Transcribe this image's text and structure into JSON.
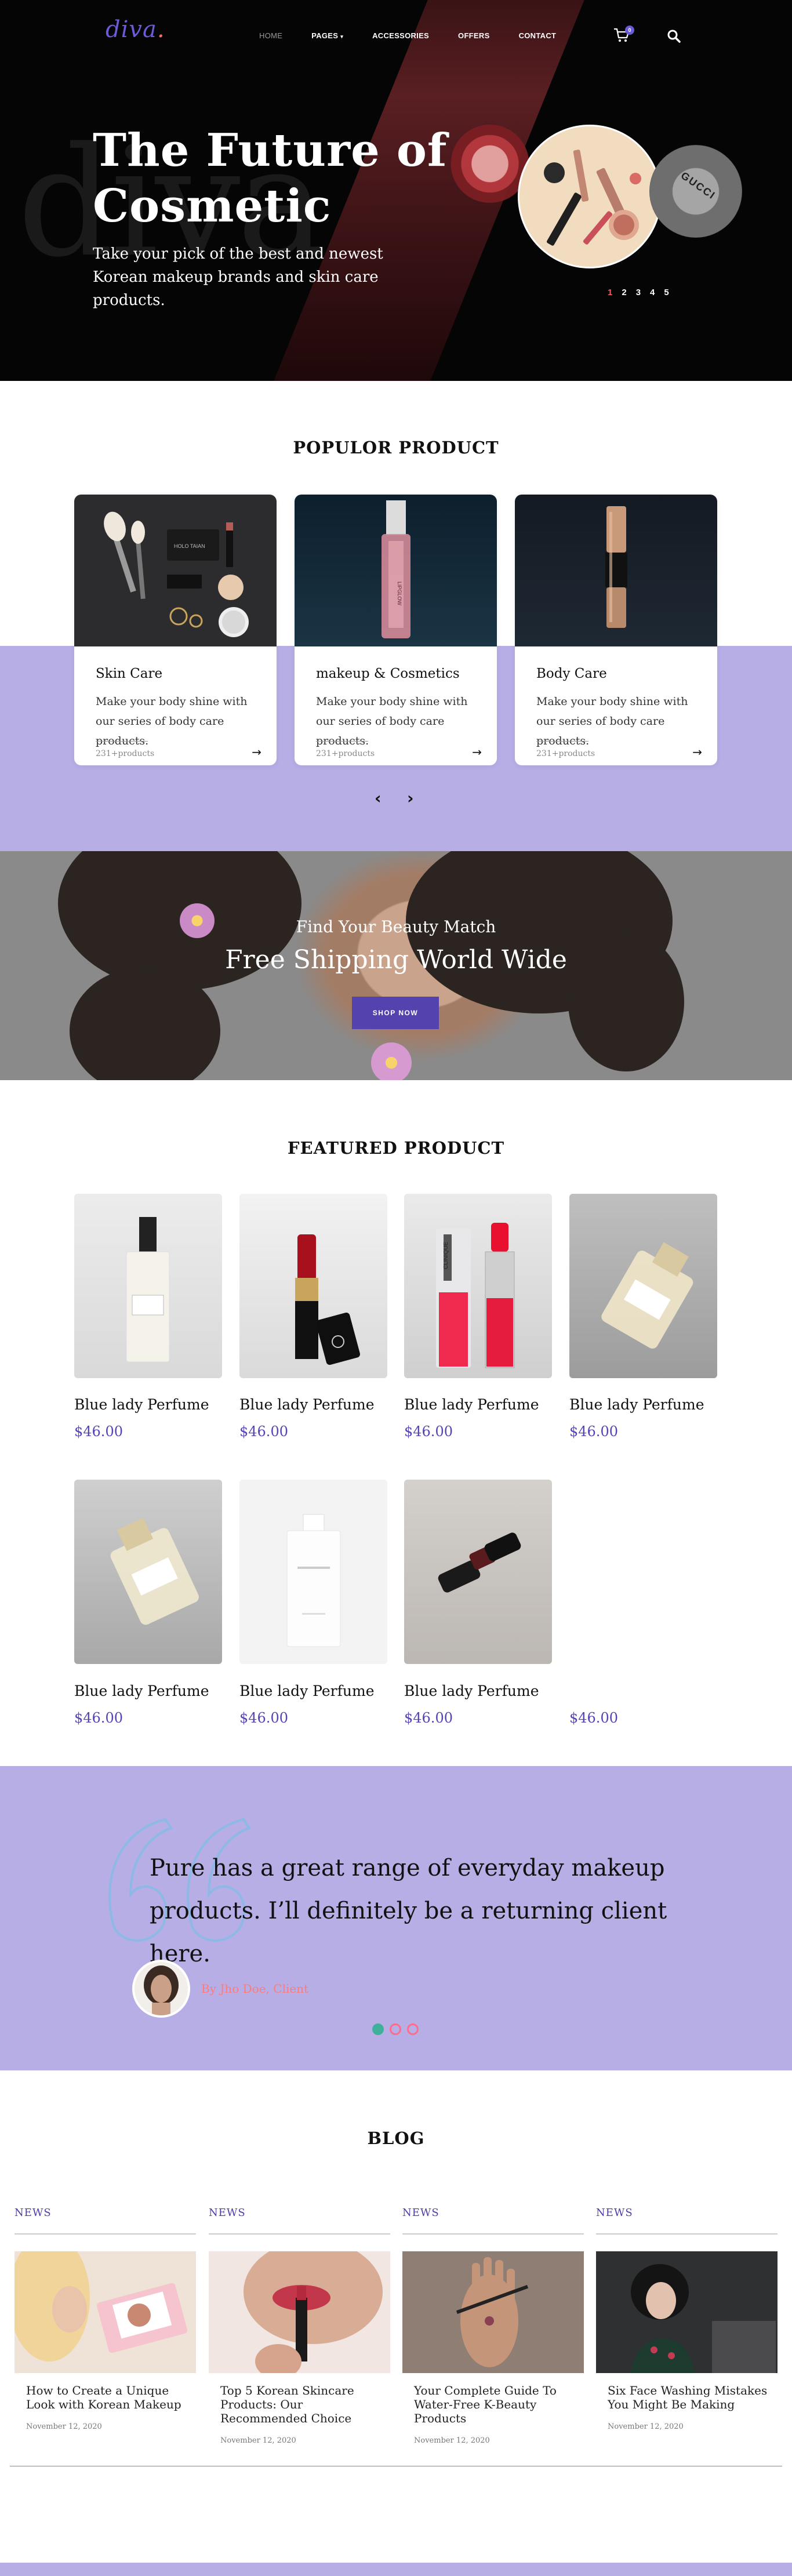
{
  "header": {
    "logo": "diva",
    "nav": [
      {
        "label": "HOME"
      },
      {
        "label": "PAGES"
      },
      {
        "label": "ACCESSORIES"
      },
      {
        "label": "OFFERS"
      },
      {
        "label": "CONTACT"
      }
    ],
    "cart_count": "0"
  },
  "hero": {
    "title": "The Future of Cosmetic",
    "subtitle": "Take your pick of the best and newest Korean makeup brands and skin care products.",
    "ghost_text": "diva",
    "badge_text": "GUCCI",
    "slides": [
      "1",
      "2",
      "3",
      "4",
      "5"
    ]
  },
  "popular": {
    "title": "POPULOR PRODUCT",
    "cards": [
      {
        "title": "Skin Care",
        "desc": "Make your body shine with our series of body care products.",
        "count": "231+products",
        "box_label": "HOLO TAIAN"
      },
      {
        "title": "makeup & Cosmetics",
        "desc": "Make your body shine with our series of body care products.",
        "count": "231+products",
        "box_label": "LIPGLOW"
      },
      {
        "title": "Body Care",
        "desc": "Make your body shine with our series of body care products.",
        "count": "231+products",
        "box_label": ""
      }
    ]
  },
  "shipping": {
    "subtitle": "Find Your Beauty Match",
    "title": "Free Shipping World Wide",
    "button": "SHOP NOW"
  },
  "featured": {
    "title": "FEATURED PRODUCT",
    "products": [
      {
        "name": "Blue lady Perfume",
        "price": "$46.00"
      },
      {
        "name": "Blue lady Perfume",
        "price": "$46.00"
      },
      {
        "name": "Blue lady Perfume",
        "price": "$46.00",
        "bottle_label": "CLINIQUE"
      },
      {
        "name": "Blue lady Perfume",
        "price": "$46.00"
      },
      {
        "name": "Blue lady Perfume",
        "price": "$46.00"
      },
      {
        "name": "Blue lady Perfume",
        "price": "$46.00"
      },
      {
        "name": "Blue lady Perfume",
        "price": "$46.00"
      },
      {
        "name": "",
        "price": "$46.00"
      }
    ]
  },
  "testimonial": {
    "text": "Pure has a great range of everyday makeup products. I’ll definitely be a returning client here.",
    "author": "By Jho Doe, Client"
  },
  "blog": {
    "title": "BLOG",
    "posts": [
      {
        "tag": "NEWS",
        "title": "How to Create a Unique Look with Korean Makeup",
        "date": "November 12, 2020"
      },
      {
        "tag": "NEWS",
        "title": "Top 5 Korean Skincare Products: Our Recommended Choice",
        "date": "November 12, 2020"
      },
      {
        "tag": "NEWS",
        "title": "Your Complete Guide To Water-Free K-Beauty Products",
        "date": "November 12, 2020"
      },
      {
        "tag": "NEWS",
        "title": "Six Face Washing Mistakes You Might Be Making",
        "date": "November 12, 2020"
      }
    ]
  },
  "colors": {
    "accent": "#5442ae",
    "lavender": "#b7aee6",
    "coral": "#ff6a6a"
  }
}
